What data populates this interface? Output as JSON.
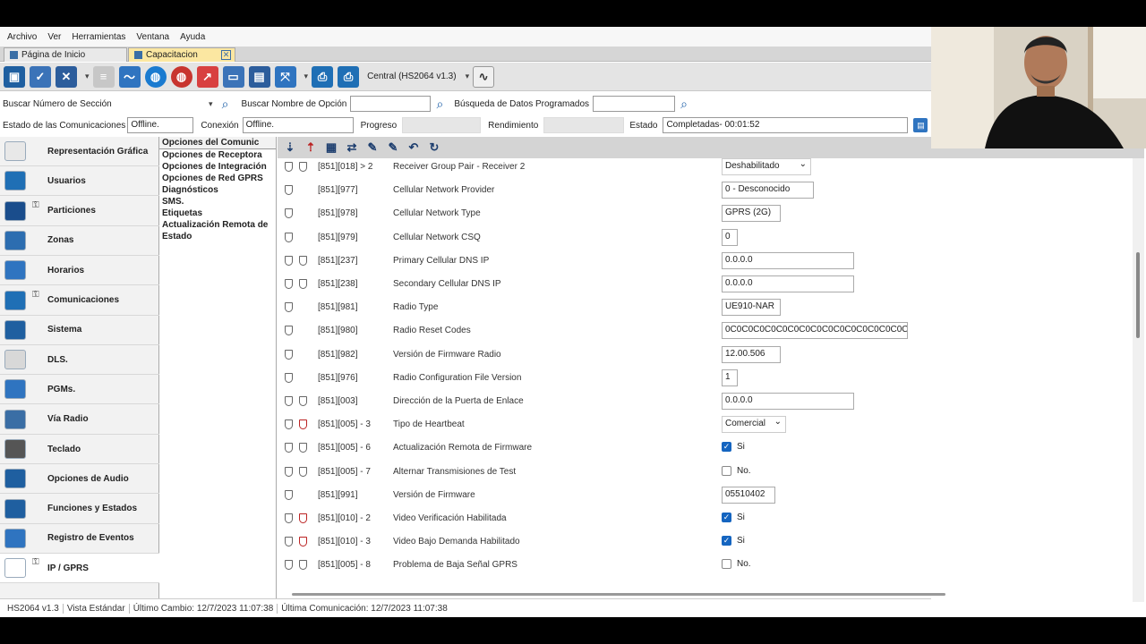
{
  "menubar": [
    "Archivo",
    "Ver",
    "Herramientas",
    "Ventana",
    "Ayuda"
  ],
  "tabs": [
    {
      "label": "Página de Inicio"
    },
    {
      "label": "Capacitacion",
      "close": "✕"
    }
  ],
  "toolbar": {
    "central_label": "Central (HS2064 v1.3)"
  },
  "search": {
    "section_label": "Buscar Número de Sección",
    "option_label": "Buscar Nombre de Opción",
    "data_label": "Búsqueda de Datos Programados"
  },
  "status": {
    "comm_label": "Estado de las Comunicaciones",
    "comm_value": "Offline.",
    "conn_label": "Conexión",
    "conn_value": "Offline.",
    "progress_label": "Progreso",
    "perf_label": "Rendimiento",
    "state_label": "Estado",
    "state_value": "Completadas- 00:01:52"
  },
  "nav": [
    {
      "label": "Representación Gráfica",
      "icon": "chart-pulse-icon",
      "color": "#e8e8e8"
    },
    {
      "label": "Usuarios",
      "icon": "users-icon",
      "color": "#1f6fb5"
    },
    {
      "label": "Particiones",
      "icon": "partitions-icon",
      "color": "#1a4d8c",
      "lock": true
    },
    {
      "label": "Zonas",
      "icon": "zones-icon",
      "color": "#2c6db0"
    },
    {
      "label": "Horarios",
      "icon": "calendar-icon",
      "color": "#2f74c0"
    },
    {
      "label": "Comunicaciones",
      "icon": "communications-icon",
      "color": "#1f6fb5",
      "lock": true
    },
    {
      "label": "Sistema",
      "icon": "system-gear-icon",
      "color": "#1f5fa0"
    },
    {
      "label": "DLS.",
      "icon": "dls-icon",
      "color": "#d8d8d8"
    },
    {
      "label": "PGMs.",
      "icon": "pgm-icon",
      "color": "#2f74c0"
    },
    {
      "label": "Vía Radio",
      "icon": "radio-icon",
      "color": "#3a6ea5"
    },
    {
      "label": "Teclado",
      "icon": "keypad-icon",
      "color": "#555"
    },
    {
      "label": "Opciones de Audio",
      "icon": "microphone-icon",
      "color": "#1f5fa0"
    },
    {
      "label": "Funciones y Estados",
      "icon": "functions-gear-icon",
      "color": "#1f5fa0"
    },
    {
      "label": "Registro de Eventos",
      "icon": "event-log-icon",
      "color": "#2f74c0"
    },
    {
      "label": "IP / GPRS",
      "icon": "wifi-icon",
      "color": "#ffffff",
      "lock": true,
      "active": true
    }
  ],
  "subnav": [
    "Opciones  del Comunic",
    "Opciones de Receptora",
    "Opciones de Integración",
    "Opciones de Red GPRS",
    "Diagnósticos",
    "SMS.",
    "Etiquetas",
    "Actualización Remota de Estado"
  ],
  "rows": [
    {
      "code": "[851][018] > 2",
      "desc": "Receiver Group Pair - Receiver 2",
      "type": "select",
      "value": "Deshabilitado",
      "shields": 2,
      "red": false
    },
    {
      "code": "[851][977]",
      "desc": "Cellular Network Provider",
      "type": "text",
      "value": "0 - Desconocido",
      "shields": 1,
      "red": false
    },
    {
      "code": "[851][978]",
      "desc": "Cellular Network Type",
      "type": "text",
      "value": "GPRS (2G)",
      "shields": 1,
      "red": false
    },
    {
      "code": "[851][979]",
      "desc": "Cellular Network CSQ",
      "type": "text",
      "value": "0",
      "shields": 1,
      "red": false
    },
    {
      "code": "[851][237]",
      "desc": "Primary Cellular DNS IP",
      "type": "text",
      "value": "0.0.0.0",
      "shields": 2,
      "red": false
    },
    {
      "code": "[851][238]",
      "desc": "Secondary Cellular DNS IP",
      "type": "text",
      "value": "0.0.0.0",
      "shields": 2,
      "red": false
    },
    {
      "code": "[851][981]",
      "desc": "Radio Type",
      "type": "text",
      "value": "UE910-NAR",
      "shields": 1,
      "red": false
    },
    {
      "code": "[851][980]",
      "desc": "Radio Reset Codes",
      "type": "text",
      "value": "0C0C0C0C0C0C0C0C0C0C0C0C0C0C0C0C",
      "shields": 1,
      "red": false
    },
    {
      "code": "[851][982]",
      "desc": "Versión de Firmware Radio",
      "type": "text",
      "value": "12.00.506",
      "shields": 1,
      "red": false
    },
    {
      "code": "[851][976]",
      "desc": "Radio Configuration File Version",
      "type": "text",
      "value": "1",
      "shields": 1,
      "red": false
    },
    {
      "code": "[851][003]",
      "desc": "Dirección de la Puerta de Enlace",
      "type": "text",
      "value": "0.0.0.0",
      "shields": 2,
      "red": false
    },
    {
      "code": "[851][005] - 3",
      "desc": "Tipo de Heartbeat",
      "type": "select",
      "value": "Comercial",
      "shields": 2,
      "red": true
    },
    {
      "code": "[851][005] - 6",
      "desc": "Actualización Remota de Firmware",
      "type": "check",
      "value": "Si",
      "checked": true,
      "shields": 2,
      "red": false
    },
    {
      "code": "[851][005] - 7",
      "desc": "Alternar Transmisiones de Test",
      "type": "check",
      "value": "No.",
      "checked": false,
      "shields": 2,
      "red": false
    },
    {
      "code": "[851][991]",
      "desc": "Versión de Firmware",
      "type": "text",
      "value": "05510402",
      "shields": 1,
      "red": false
    },
    {
      "code": "[851][010] - 2",
      "desc": "Video Verificación Habilitada",
      "type": "check",
      "value": "Si",
      "checked": true,
      "shields": 2,
      "red": true
    },
    {
      "code": "[851][010] - 3",
      "desc": "Video Bajo Demanda Habilitado",
      "type": "check",
      "value": "Si",
      "checked": true,
      "shields": 2,
      "red": true
    },
    {
      "code": "[851][005] - 8",
      "desc": "Problema de Baja Señal GPRS",
      "type": "check",
      "value": "No.",
      "checked": false,
      "shields": 2,
      "red": false
    }
  ],
  "statusbar": [
    "HS2064 v1.3",
    "Vista Estándar",
    "Último Cambio: 12/7/2023 11:07:38",
    "Última Comunicación: 12/7/2023 11:07:38"
  ],
  "colors": {
    "accent": "#1565c0",
    "tab_active": "#fbe7a1"
  }
}
